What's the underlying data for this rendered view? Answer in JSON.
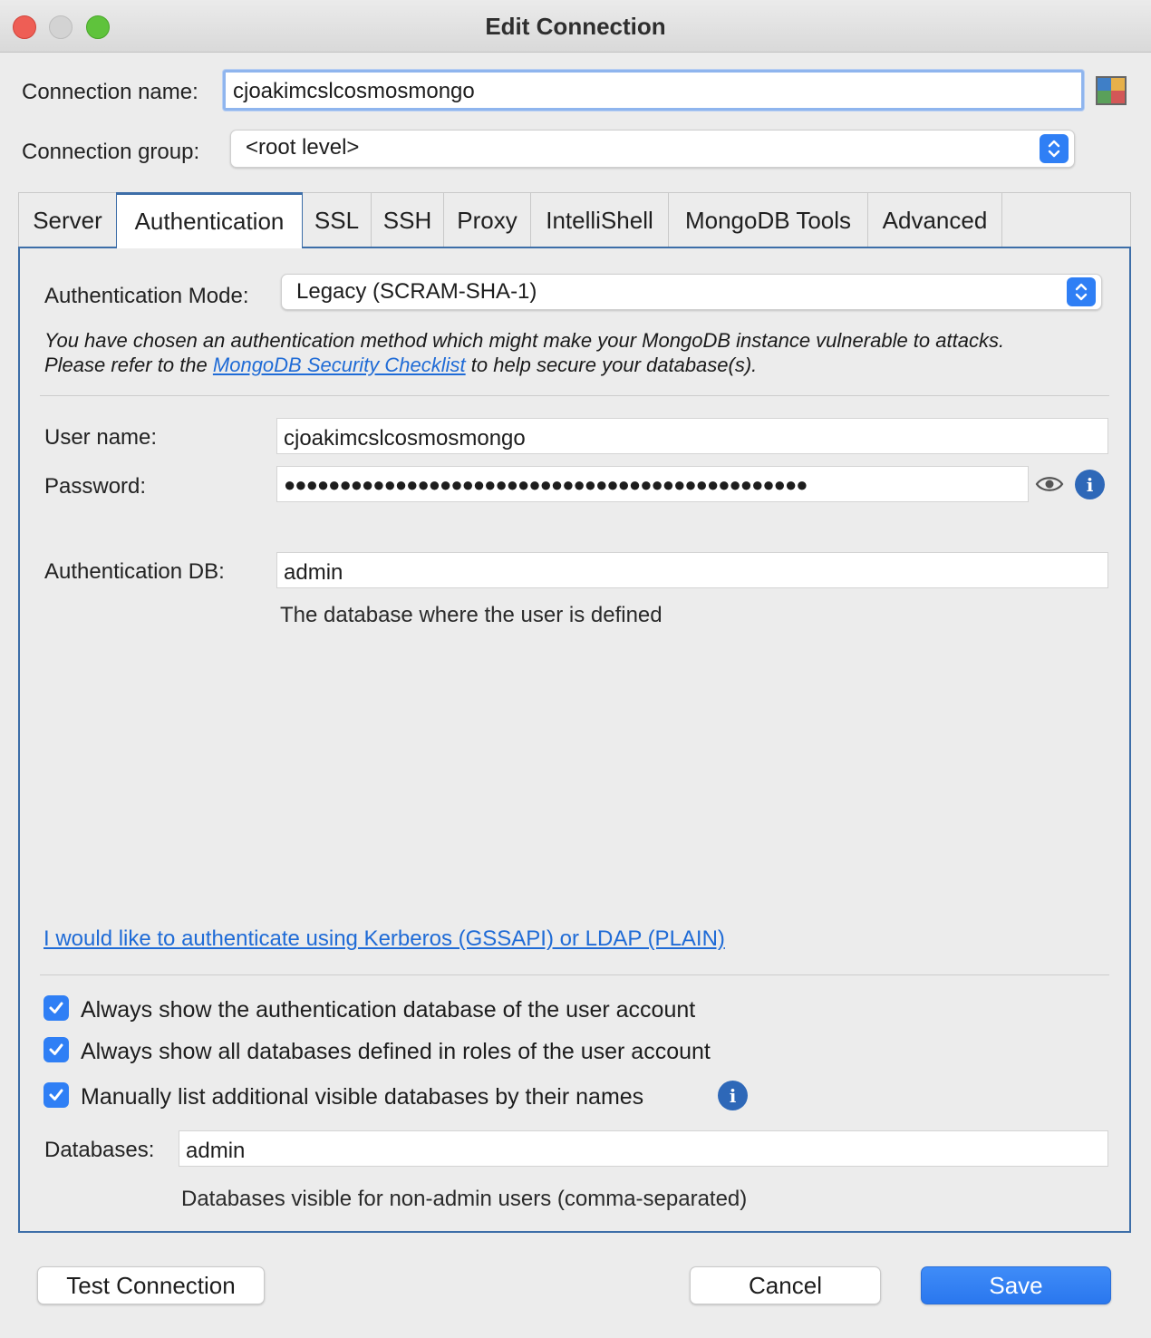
{
  "window": {
    "title": "Edit Connection"
  },
  "connection": {
    "name_label": "Connection name:",
    "name_value": "cjoakimcslcosmosmongo",
    "group_label": "Connection group:",
    "group_value": "<root level>"
  },
  "tabs": [
    {
      "label": "Server"
    },
    {
      "label": "Authentication"
    },
    {
      "label": "SSL"
    },
    {
      "label": "SSH"
    },
    {
      "label": "Proxy"
    },
    {
      "label": "IntelliShell"
    },
    {
      "label": "MongoDB Tools"
    },
    {
      "label": "Advanced"
    }
  ],
  "auth": {
    "mode_label": "Authentication Mode:",
    "mode_value": "Legacy (SCRAM-SHA-1)",
    "warning_line1": "You have chosen an authentication method which might make your MongoDB instance vulnerable to attacks.",
    "warning_line2_pre": "Please refer to the ",
    "warning_link": "MongoDB Security Checklist",
    "warning_line2_post": " to help secure your database(s).",
    "user_label": "User name:",
    "user_value": "cjoakimcslcosmosmongo",
    "password_label": "Password:",
    "password_mask": "●●●●●●●●●●●●●●●●●●●●●●●●●●●●●●●●●●●●●●●●●●●●●●●",
    "authdb_label": "Authentication DB:",
    "authdb_value": "admin",
    "authdb_hint": "The database where the user is defined",
    "kerberos_link": "I would like to authenticate using Kerberos (GSSAPI) or LDAP (PLAIN)"
  },
  "options": [
    {
      "label": "Always show the authentication database of the user account",
      "checked": true
    },
    {
      "label": "Always show all databases defined in roles of the user account",
      "checked": true
    },
    {
      "label": "Manually list additional visible databases by their names",
      "checked": true
    }
  ],
  "databases": {
    "label": "Databases:",
    "value": "admin",
    "hint": "Databases visible for non-admin users (comma-separated)"
  },
  "buttons": {
    "test": "Test Connection",
    "cancel": "Cancel",
    "save": "Save"
  },
  "colors": {
    "accent": "#2f7ff5",
    "tab_border": "#3d6ea8",
    "link": "#1f6bd6"
  }
}
